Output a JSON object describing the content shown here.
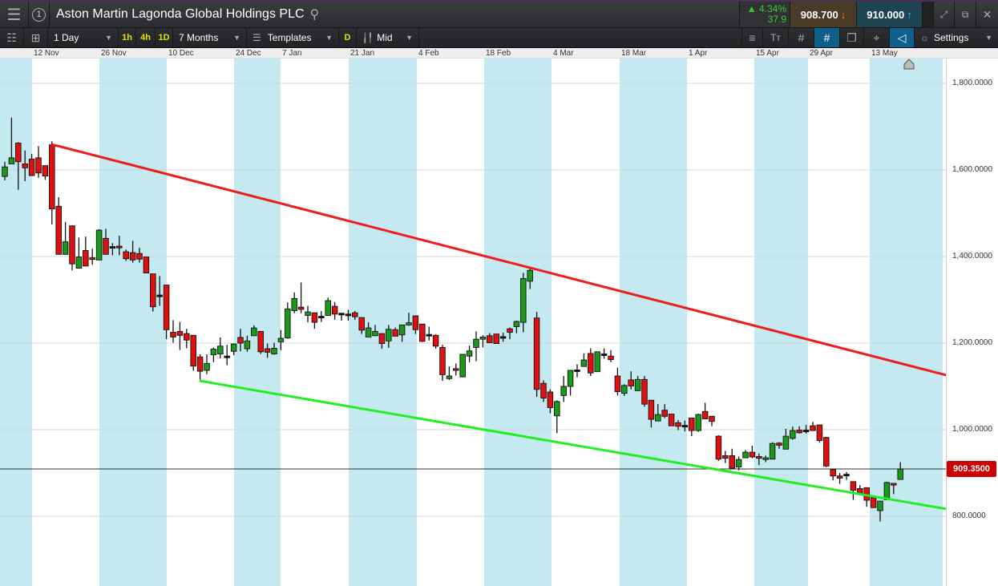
{
  "header": {
    "title": "Aston Martin Lagonda Global Holdings PLC",
    "layout_number": "1",
    "change_pct": "▲ 4.34%",
    "change_abs": "37.9",
    "sell_price": "908.700",
    "buy_price": "910.000"
  },
  "toolbar": {
    "interval": "1 Day",
    "quick_1h": "1h",
    "quick_4h": "4h",
    "quick_1d": "1D",
    "range": "7 Months",
    "templates": "Templates",
    "d_button": "D",
    "price_type": "Mid",
    "settings": "Settings"
  },
  "date_labels": [
    "12 Nov",
    "26 Nov",
    "10 Dec",
    "24 Dec",
    "7 Jan",
    "21 Jan",
    "4 Feb",
    "18 Feb",
    "4 Mar",
    "18 Mar",
    "1 Apr",
    "15 Apr",
    "29 Apr",
    "13 May"
  ],
  "y_labels": [
    "1,800.0000",
    "1,600.0000",
    "1,400.0000",
    "1,200.0000",
    "1,000.0000",
    "800.0000"
  ],
  "current_price_label": "909.3500",
  "colors": {
    "up": "#1a9a1a",
    "down": "#e01010",
    "resistance": "#ee1c1c",
    "support": "#22ee22",
    "band": "#c5e9f0"
  },
  "chart_data": {
    "type": "candlestick",
    "title": "Aston Martin Lagonda Global Holdings PLC",
    "interval": "1 Day",
    "ylim": [
      700,
      1815
    ],
    "y_ticks": [
      1800,
      1600,
      1400,
      1200,
      1000,
      800
    ],
    "current_price": 909.35,
    "candles_ohlc": [
      [
        1585,
        1619,
        1576,
        1607
      ],
      [
        1614,
        1721,
        1614,
        1628
      ],
      [
        1662,
        1664,
        1554,
        1619
      ],
      [
        1614,
        1645,
        1574,
        1605
      ],
      [
        1625,
        1637,
        1587,
        1587
      ],
      [
        1628,
        1655,
        1582,
        1593
      ],
      [
        1610,
        1610,
        1577,
        1586
      ],
      [
        1658,
        1666,
        1474,
        1510
      ],
      [
        1516,
        1537,
        1405,
        1405
      ],
      [
        1405,
        1480,
        1405,
        1434
      ],
      [
        1471,
        1471,
        1368,
        1383
      ],
      [
        1373,
        1444,
        1373,
        1399
      ],
      [
        1414,
        1446,
        1378,
        1378
      ],
      [
        1397,
        1418,
        1381,
        1394
      ],
      [
        1392,
        1463,
        1392,
        1461
      ],
      [
        1442,
        1464,
        1405,
        1405
      ],
      [
        1423,
        1431,
        1403,
        1423
      ],
      [
        1424,
        1448,
        1403,
        1420
      ],
      [
        1411,
        1416,
        1390,
        1395
      ],
      [
        1409,
        1436,
        1386,
        1392
      ],
      [
        1407,
        1420,
        1386,
        1394
      ],
      [
        1399,
        1399,
        1362,
        1362
      ],
      [
        1360,
        1360,
        1273,
        1284
      ],
      [
        1311,
        1355,
        1286,
        1311
      ],
      [
        1334,
        1334,
        1209,
        1231
      ],
      [
        1225,
        1253,
        1201,
        1214
      ],
      [
        1227,
        1249,
        1184,
        1218
      ],
      [
        1222,
        1233,
        1188,
        1207
      ],
      [
        1218,
        1218,
        1136,
        1147
      ],
      [
        1168,
        1174,
        1116,
        1135
      ],
      [
        1137,
        1174,
        1128,
        1153
      ],
      [
        1173,
        1190,
        1156,
        1186
      ],
      [
        1175,
        1213,
        1165,
        1193
      ],
      [
        1170,
        1196,
        1149,
        1170
      ],
      [
        1181,
        1199,
        1172,
        1198
      ],
      [
        1213,
        1233,
        1181,
        1200
      ],
      [
        1187,
        1217,
        1180,
        1205
      ],
      [
        1217,
        1241,
        1217,
        1235
      ],
      [
        1227,
        1227,
        1175,
        1180
      ],
      [
        1187,
        1199,
        1166,
        1179
      ],
      [
        1175,
        1201,
        1173,
        1188
      ],
      [
        1203,
        1230,
        1184,
        1211
      ],
      [
        1212,
        1294,
        1210,
        1279
      ],
      [
        1275,
        1317,
        1269,
        1303
      ],
      [
        1283,
        1340,
        1269,
        1278
      ],
      [
        1264,
        1286,
        1248,
        1272
      ],
      [
        1270,
        1270,
        1233,
        1248
      ],
      [
        1262,
        1274,
        1249,
        1262
      ],
      [
        1264,
        1305,
        1264,
        1298
      ],
      [
        1285,
        1295,
        1254,
        1267
      ],
      [
        1269,
        1269,
        1252,
        1269
      ],
      [
        1267,
        1277,
        1252,
        1267
      ],
      [
        1270,
        1274,
        1254,
        1261
      ],
      [
        1259,
        1259,
        1221,
        1230
      ],
      [
        1214,
        1248,
        1214,
        1235
      ],
      [
        1217,
        1242,
        1217,
        1227
      ],
      [
        1222,
        1222,
        1187,
        1199
      ],
      [
        1205,
        1242,
        1189,
        1232
      ],
      [
        1231,
        1236,
        1216,
        1216
      ],
      [
        1219,
        1242,
        1203,
        1242
      ],
      [
        1242,
        1270,
        1240,
        1247
      ],
      [
        1263,
        1263,
        1221,
        1231
      ],
      [
        1244,
        1244,
        1203,
        1204
      ],
      [
        1220,
        1238,
        1206,
        1220
      ],
      [
        1218,
        1220,
        1187,
        1193
      ],
      [
        1190,
        1196,
        1113,
        1127
      ],
      [
        1118,
        1146,
        1115,
        1124
      ],
      [
        1141,
        1153,
        1125,
        1137
      ],
      [
        1122,
        1175,
        1122,
        1174
      ],
      [
        1170,
        1194,
        1156,
        1182
      ],
      [
        1190,
        1227,
        1158,
        1209
      ],
      [
        1209,
        1218,
        1190,
        1214
      ],
      [
        1217,
        1223,
        1201,
        1201
      ],
      [
        1221,
        1221,
        1199,
        1199
      ],
      [
        1215,
        1224,
        1203,
        1215
      ],
      [
        1233,
        1236,
        1209,
        1225
      ],
      [
        1238,
        1252,
        1223,
        1250
      ],
      [
        1248,
        1362,
        1225,
        1349
      ],
      [
        1343,
        1372,
        1325,
        1368
      ],
      [
        1258,
        1272,
        1076,
        1093
      ],
      [
        1107,
        1114,
        1064,
        1073
      ],
      [
        1087,
        1093,
        1038,
        1051
      ],
      [
        1032,
        1068,
        992,
        1065
      ],
      [
        1079,
        1124,
        1064,
        1100
      ],
      [
        1100,
        1138,
        1079,
        1137
      ],
      [
        1138,
        1151,
        1121,
        1138
      ],
      [
        1146,
        1176,
        1146,
        1161
      ],
      [
        1176,
        1188,
        1124,
        1131
      ],
      [
        1134,
        1180,
        1134,
        1180
      ],
      [
        1175,
        1188,
        1164,
        1175
      ],
      [
        1170,
        1184,
        1156,
        1162
      ],
      [
        1124,
        1143,
        1079,
        1088
      ],
      [
        1084,
        1105,
        1078,
        1102
      ],
      [
        1115,
        1135,
        1093,
        1101
      ],
      [
        1090,
        1124,
        1090,
        1116
      ],
      [
        1116,
        1124,
        1053,
        1059
      ],
      [
        1068,
        1068,
        1005,
        1024
      ],
      [
        1020,
        1059,
        1020,
        1035
      ],
      [
        1045,
        1059,
        1027,
        1031
      ],
      [
        1036,
        1036,
        1009,
        1009
      ],
      [
        1016,
        1022,
        999,
        1008
      ],
      [
        1010,
        1021,
        996,
        1010
      ],
      [
        1027,
        1027,
        985,
        998
      ],
      [
        998,
        1037,
        995,
        1035
      ],
      [
        1042,
        1062,
        1025,
        1025
      ],
      [
        1031,
        1031,
        1008,
        1019
      ],
      [
        985,
        987,
        928,
        932
      ],
      [
        940,
        951,
        923,
        934
      ],
      [
        940,
        956,
        911,
        911
      ],
      [
        914,
        938,
        906,
        931
      ],
      [
        935,
        953,
        935,
        948
      ],
      [
        948,
        963,
        934,
        937
      ],
      [
        938,
        945,
        918,
        934
      ],
      [
        931,
        940,
        925,
        935
      ],
      [
        932,
        971,
        932,
        968
      ],
      [
        969,
        971,
        956,
        964
      ],
      [
        955,
        1002,
        955,
        985
      ],
      [
        980,
        1007,
        977,
        998
      ],
      [
        999,
        1008,
        991,
        993
      ],
      [
        999,
        1011,
        991,
        999
      ],
      [
        1009,
        1018,
        998,
        998
      ],
      [
        1011,
        1011,
        970,
        975
      ],
      [
        982,
        983,
        914,
        916
      ],
      [
        908,
        908,
        883,
        893
      ],
      [
        893,
        900,
        875,
        888
      ],
      [
        897,
        902,
        884,
        897
      ],
      [
        880,
        880,
        838,
        860
      ],
      [
        864,
        872,
        853,
        853
      ],
      [
        866,
        866,
        822,
        837
      ],
      [
        843,
        848,
        820,
        820
      ],
      [
        813,
        835,
        788,
        835
      ],
      [
        838,
        880,
        838,
        878
      ],
      [
        876,
        876,
        851,
        872
      ],
      [
        885,
        925,
        909,
        909
      ]
    ],
    "trendlines": [
      {
        "name": "resistance",
        "from": {
          "bar": 7,
          "price": 1659
        },
        "to": {
          "bar": 139.8,
          "price": 1126
        }
      },
      {
        "name": "support",
        "from": {
          "bar": 28.9,
          "price": 1113
        },
        "to": {
          "bar": 139.8,
          "price": 817
        }
      }
    ]
  }
}
